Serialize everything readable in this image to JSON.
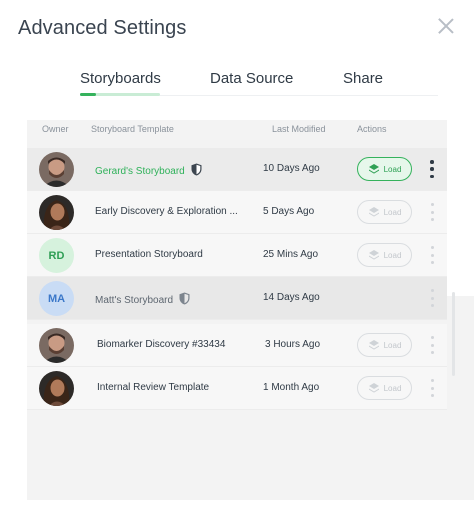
{
  "header": {
    "title": "Advanced Settings"
  },
  "tabs": [
    {
      "label": "Storyboards",
      "active": true
    },
    {
      "label": "Data Source",
      "active": false
    },
    {
      "label": "Share",
      "active": false
    }
  ],
  "table": {
    "columns": {
      "owner": "Owner",
      "template": "Storyboard Template",
      "modified": "Last Modified",
      "actions": "Actions"
    },
    "rows": [
      {
        "avatar": "photo-man",
        "name": "Gerard's Storyboard",
        "shield": true,
        "modified": "10 Days Ago",
        "action": "Load",
        "active": true
      },
      {
        "avatar": "photo-woman",
        "name": "Early Discovery & Exploration ...",
        "shield": false,
        "modified": "5 Days Ago",
        "action": "Load",
        "active": false
      },
      {
        "avatar": "RD",
        "name": "Presentation Storyboard",
        "shield": false,
        "modified": "25 Mins Ago",
        "action": "Load",
        "active": false
      },
      {
        "avatar": "MA",
        "name": "Matt's Storyboard",
        "shield": true,
        "modified": "14 Days Ago",
        "action": "",
        "active": false
      },
      {
        "avatar": "photo-man",
        "name": "Biomarker Discovery #33434",
        "shield": false,
        "modified": "3 Hours Ago",
        "action": "Load",
        "active": false
      },
      {
        "avatar": "photo-woman",
        "name": "Internal Review Template",
        "shield": false,
        "modified": "1 Month Ago",
        "action": "Load",
        "active": false
      }
    ]
  },
  "colors": {
    "accent": "#35b25c",
    "accent_light": "#e6f7eb"
  }
}
